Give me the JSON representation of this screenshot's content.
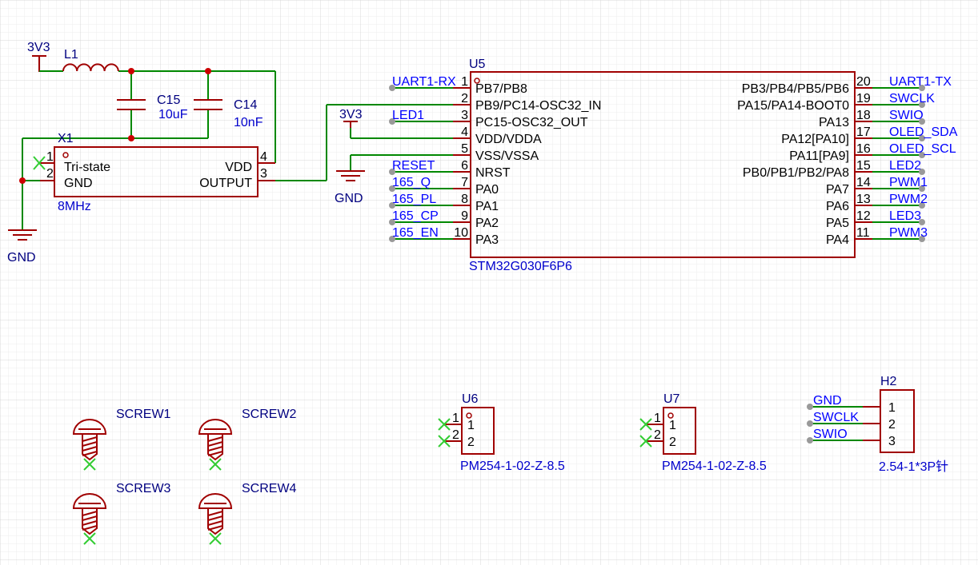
{
  "grid": {
    "major_color": "#d8d8d8",
    "minor_color": "#eeeeee"
  },
  "colors": {
    "wire": "#008800",
    "component": "#a00000",
    "junction": "#cc0000",
    "designator": "#000080",
    "net_label": "#0000ff",
    "no_connect": "#33cc33",
    "port": "#999999"
  },
  "power": {
    "vcc1": "3V3",
    "vcc2": "3V3",
    "gnd1": "GND",
    "gnd2": "GND"
  },
  "components": {
    "l1": {
      "designator": "L1"
    },
    "c15": {
      "designator": "C15",
      "value": "10uF"
    },
    "c14": {
      "designator": "C14",
      "value": "10nF"
    },
    "x1": {
      "designator": "X1",
      "value": "8MHz",
      "pins": [
        {
          "num": "1",
          "name": "Tri-state"
        },
        {
          "num": "2",
          "name": "GND"
        },
        {
          "num": "3",
          "name": "OUTPUT"
        },
        {
          "num": "4",
          "name": "VDD"
        }
      ]
    },
    "u5": {
      "designator": "U5",
      "value": "STM32G030F6P6",
      "left_pins": [
        {
          "num": "1",
          "name": "PB7/PB8",
          "net": "UART1-RX"
        },
        {
          "num": "2",
          "name": "PB9/PC14-OSC32_IN",
          "net": ""
        },
        {
          "num": "3",
          "name": "PC15-OSC32_OUT",
          "net": "LED1"
        },
        {
          "num": "4",
          "name": "VDD/VDDA",
          "net": ""
        },
        {
          "num": "5",
          "name": "VSS/VSSA",
          "net": ""
        },
        {
          "num": "6",
          "name": "NRST",
          "net": "RESET"
        },
        {
          "num": "7",
          "name": "PA0",
          "net": "165_Q"
        },
        {
          "num": "8",
          "name": "PA1",
          "net": "165_PL"
        },
        {
          "num": "9",
          "name": "PA2",
          "net": "165_CP"
        },
        {
          "num": "10",
          "name": "PA3",
          "net": "165_EN"
        }
      ],
      "right_pins": [
        {
          "num": "20",
          "name": "PB3/PB4/PB5/PB6",
          "net": "UART1-TX"
        },
        {
          "num": "19",
          "name": "PA15/PA14-BOOT0",
          "net": "SWCLK"
        },
        {
          "num": "18",
          "name": "PA13",
          "net": "SWIO"
        },
        {
          "num": "17",
          "name": "PA12[PA10]",
          "net": "OLED_SDA"
        },
        {
          "num": "16",
          "name": "PA11[PA9]",
          "net": "OLED_SCL"
        },
        {
          "num": "15",
          "name": "PB0/PB1/PB2/PA8",
          "net": "LED2"
        },
        {
          "num": "14",
          "name": "PA7",
          "net": "PWM1"
        },
        {
          "num": "13",
          "name": "PA6",
          "net": "PWM2"
        },
        {
          "num": "12",
          "name": "PA5",
          "net": "LED3"
        },
        {
          "num": "11",
          "name": "PA4",
          "net": "PWM3"
        }
      ]
    },
    "u6": {
      "designator": "U6",
      "value": "PM254-1-02-Z-8.5",
      "pins": [
        {
          "num": "1",
          "name": "1"
        },
        {
          "num": "2",
          "name": "2"
        }
      ]
    },
    "u7": {
      "designator": "U7",
      "value": "PM254-1-02-Z-8.5",
      "pins": [
        {
          "num": "1",
          "name": "1"
        },
        {
          "num": "2",
          "name": "2"
        }
      ]
    },
    "h2": {
      "designator": "H2",
      "value": "2.54-1*3P针",
      "pins": [
        {
          "num": "1",
          "net": "GND"
        },
        {
          "num": "2",
          "net": "SWCLK"
        },
        {
          "num": "3",
          "net": "SWIO"
        }
      ]
    },
    "screws": [
      {
        "designator": "SCREW1"
      },
      {
        "designator": "SCREW2"
      },
      {
        "designator": "SCREW3"
      },
      {
        "designator": "SCREW4"
      }
    ]
  }
}
